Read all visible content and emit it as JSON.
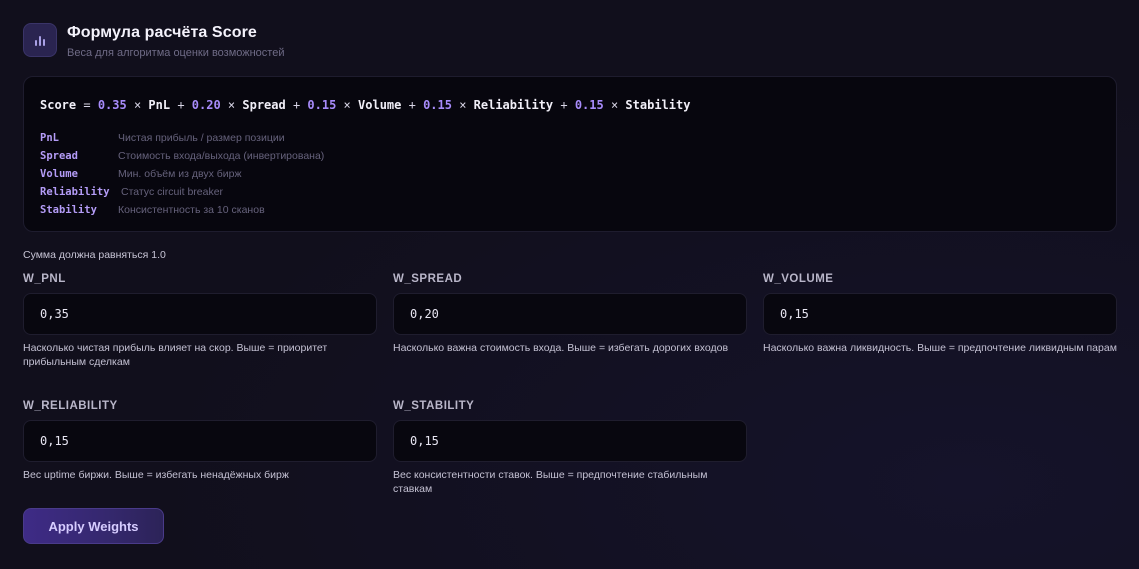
{
  "header": {
    "icon": "bar-chart-icon",
    "title": "Формула расчёта Score",
    "subtitle": "Веса для алгоритма оценки возможностей"
  },
  "formula": {
    "lhs": "Score",
    "terms": [
      {
        "weight": "0.35",
        "name": "PnL"
      },
      {
        "weight": "0.20",
        "name": "Spread"
      },
      {
        "weight": "0.15",
        "name": "Volume"
      },
      {
        "weight": "0.15",
        "name": "Reliability"
      },
      {
        "weight": "0.15",
        "name": "Stability"
      }
    ],
    "legend": [
      {
        "key": "PnL",
        "desc": "Чистая прибыль / размер позиции"
      },
      {
        "key": "Spread",
        "desc": "Стоимость входа/выхода (инвертирована)"
      },
      {
        "key": "Volume",
        "desc": "Мин. объём из двух бирж"
      },
      {
        "key": "Reliability",
        "desc": "Статус circuit breaker"
      },
      {
        "key": "Stability",
        "desc": "Консистентность за 10 сканов"
      }
    ]
  },
  "sum_note": "Сумма должна равняться 1.0",
  "fields": [
    {
      "label": "W_PNL",
      "value": "0,35",
      "help": "Насколько чистая прибыль влияет на скор. Выше = приоритет прибыльным сделкам"
    },
    {
      "label": "W_SPREAD",
      "value": "0,20",
      "help": "Насколько важна стоимость входа. Выше = избегать дорогих входов"
    },
    {
      "label": "W_VOLUME",
      "value": "0,15",
      "help": "Насколько важна ликвидность. Выше = предпочтение ликвидным парам"
    },
    {
      "label": "W_RELIABILITY",
      "value": "0,15",
      "help": "Вес uptime биржи. Выше = избегать ненадёжных бирж"
    },
    {
      "label": "W_STABILITY",
      "value": "0,15",
      "help": "Вес консистентности ставок. Выше = предпочтение стабильным ставкам"
    }
  ],
  "apply_button": "Apply Weights",
  "colors": {
    "background": "#110f1c",
    "accent": "#a78bfa",
    "button": "#3e2b86"
  }
}
